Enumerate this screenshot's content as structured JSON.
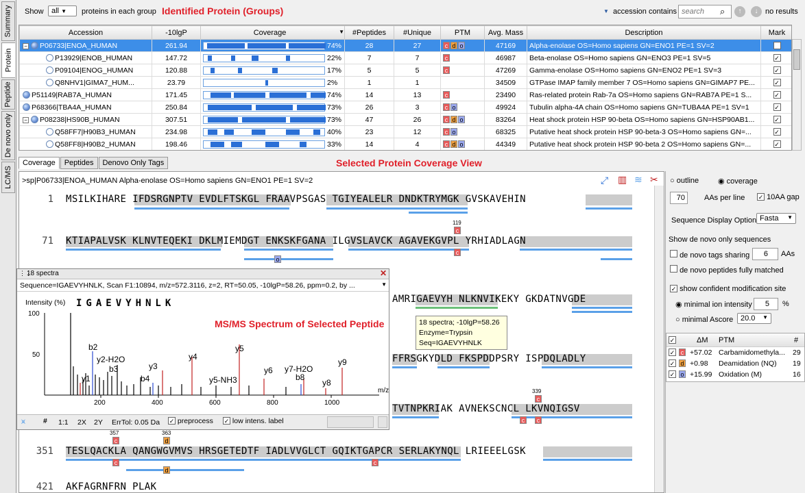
{
  "vertical_tabs": [
    "Summary",
    "Protein",
    "Peptide",
    "De novo only",
    "LC/MS"
  ],
  "topbar": {
    "show_label": "Show",
    "show_value": "all",
    "show_suffix": "proteins in each group",
    "filter_label": "accession contains",
    "search_placeholder": "search",
    "results": "no results"
  },
  "annotations": {
    "identified": "Identified Protein (Groups)",
    "coverage_view": "Selected Protein Coverage View",
    "msms": "MS/MS Spectrum of Selected Peptide"
  },
  "columns": [
    "Accession",
    "-10lgP",
    "Coverage",
    "#Peptides",
    "#Unique",
    "PTM",
    "Avg. Mass",
    "Description",
    "Mark"
  ],
  "rows": [
    {
      "acc": "P06733|ENOA_HUMAN",
      "lgp": "261.94",
      "cov": "74%",
      "pep": "28",
      "uniq": "27",
      "ptm": [
        "c",
        "d",
        "o"
      ],
      "mass": "47169",
      "desc": "Alpha-enolase OS=Homo sapiens GN=ENO1 PE=1 SV=2",
      "level": 0,
      "expand": "−",
      "selected": true
    },
    {
      "acc": "P13929|ENOB_HUMAN",
      "lgp": "147.72",
      "cov": "22%",
      "pep": "7",
      "uniq": "7",
      "ptm": [
        "c"
      ],
      "mass": "46987",
      "desc": "Beta-enolase OS=Homo sapiens GN=ENO3 PE=1 SV=5",
      "level": 1
    },
    {
      "acc": "P09104|ENOG_HUMAN",
      "lgp": "120.88",
      "cov": "17%",
      "pep": "5",
      "uniq": "5",
      "ptm": [
        "c"
      ],
      "mass": "47269",
      "desc": "Gamma-enolase OS=Homo sapiens GN=ENO2 PE=1 SV=3",
      "level": 1
    },
    {
      "acc": "Q8NHV1|GIMA7_HUM...",
      "lgp": "23.79",
      "cov": "2%",
      "pep": "1",
      "uniq": "1",
      "ptm": [],
      "mass": "34509",
      "desc": "GTPase IMAP family member 7 OS=Homo sapiens GN=GIMAP7 PE...",
      "level": 1
    },
    {
      "acc": "P51149|RAB7A_HUMAN",
      "lgp": "171.45",
      "cov": "74%",
      "pep": "14",
      "uniq": "13",
      "ptm": [
        "c"
      ],
      "mass": "23490",
      "desc": "Ras-related protein Rab-7a OS=Homo sapiens GN=RAB7A PE=1 S...",
      "level": 0
    },
    {
      "acc": "P68366|TBA4A_HUMAN",
      "lgp": "250.84",
      "cov": "73%",
      "pep": "26",
      "uniq": "3",
      "ptm": [
        "c",
        "o"
      ],
      "mass": "49924",
      "desc": "Tubulin alpha-4A chain OS=Homo sapiens GN=TUBA4A PE=1 SV=1",
      "level": 0
    },
    {
      "acc": "P08238|HS90B_HUMAN",
      "lgp": "307.51",
      "cov": "73%",
      "pep": "47",
      "uniq": "26",
      "ptm": [
        "c",
        "d",
        "o"
      ],
      "mass": "83264",
      "desc": "Heat shock protein HSP 90-beta OS=Homo sapiens GN=HSP90AB1...",
      "level": 0,
      "expand": "−"
    },
    {
      "acc": "Q58FF7|H90B3_HUMAN",
      "lgp": "234.98",
      "cov": "40%",
      "pep": "23",
      "uniq": "12",
      "ptm": [
        "c",
        "o"
      ],
      "mass": "68325",
      "desc": "Putative heat shock protein HSP 90-beta-3 OS=Homo sapiens GN=...",
      "level": 1
    },
    {
      "acc": "Q58FF8|H90B2_HUMAN",
      "lgp": "198.46",
      "cov": "33%",
      "pep": "14",
      "uniq": "4",
      "ptm": [
        "c",
        "d",
        "o"
      ],
      "mass": "44349",
      "desc": "Putative heat shock protein HSP 90-beta 2 OS=Homo sapiens GN=...",
      "level": 1
    }
  ],
  "lower_tabs": [
    "Coverage",
    "Peptides",
    "Denovo Only Tags"
  ],
  "coverage_header": ">sp|P06733|ENOA_HUMAN Alpha-enolase OS=Homo sapiens GN=ENO1 PE=1 SV=2",
  "seq_lines": [
    {
      "n": "1",
      "text": "MSILKIHARE IFDSRGNPTV EVDLFTSKGL FRAAVPSGAS TGIYEALELR DNDKTRYMGK GVSKAVEHIN"
    },
    {
      "n": "71",
      "text": "KTIAPALVSK KLNVTEQEKI DKLMIEMDGT ENKSKFGANA ILGVSLAVCK AGAVEKGVPL YRHIADLAGN"
    },
    {
      "n": "",
      "text": "AMRIGAEVYH NLKNVIKEKY GKDATNVGDE"
    },
    {
      "n": "",
      "text": "FFRSGKYDLD FKSPDDPSRY ISPDQLADLY"
    },
    {
      "n": "",
      "text": "TVTNPKRIAK AVNEKSCNCL LKVNQIGSV"
    },
    {
      "n": "351",
      "text": "TESLQACKLA QANGWGVMVS HRSGETEDTF IADLVVGLCT GQIKTGAPCR SERLAKYNQL LRIEEELGSK"
    },
    {
      "n": "421",
      "text": "AKFAGRNFRN PLAK"
    }
  ],
  "mod_positions": {
    "p119": "119",
    "p339": "339",
    "p357": "357",
    "p363": "363"
  },
  "tooltip": {
    "l1": "18 spectra; -10lgP=58.26",
    "l2": "Enzyme=Trypsin",
    "l3": "Seq=IGAEVYHNLK"
  },
  "right_panel": {
    "outline": "outline",
    "coverage": "coverage",
    "aas_value": "70",
    "aas_label": "AAs per line",
    "gap_label": "10AA gap",
    "display_label": "Sequence Display Option",
    "display_value": "Fasta",
    "denovo_title": "Show de novo only sequences",
    "tags_label": "de novo tags sharing",
    "tags_value": "6",
    "tags_suffix": "AAs",
    "fully_label": "de novo peptides fully matched",
    "conf_label": "show confident modification site",
    "ion_label": "minimal ion intensity",
    "ion_value": "5",
    "ion_suffix": "%",
    "ascore_label": "minimal Ascore",
    "ascore_value": "20.0",
    "ptm_cols": [
      "ΔM",
      "PTM",
      "#"
    ],
    "ptms": [
      {
        "code": "c",
        "dm": "+57.02",
        "name": "Carbamidomethyla...",
        "n": "29"
      },
      {
        "code": "d",
        "dm": "+0.98",
        "name": "Deamidation (NQ)",
        "n": "19"
      },
      {
        "code": "o",
        "dm": "+15.99",
        "name": "Oxidation (M)",
        "n": "16"
      }
    ]
  },
  "spectrum": {
    "title": "18 spectra",
    "info": "Sequence=IGAEVYHNLK, Scan F1:10894, m/z=572.3116, z=2, RT=50.05, -10lgP=58.26, ppm=0.2, by ...",
    "ylabel": "Intensity (%)",
    "peptide": "IGAEVYHNLK",
    "xlabel": "m/z",
    "y100": "100",
    "y50": "50",
    "xticks": [
      "200",
      "400",
      "600",
      "800",
      "1000"
    ],
    "ions": [
      "b2",
      "y2-H2O",
      "b3",
      "y1",
      "y3",
      "b4",
      "y4",
      "y5-NH3",
      "y5",
      "y6",
      "y7-H2O",
      "b8",
      "y8",
      "y9"
    ],
    "tb": {
      "ratio": "1:1",
      "x2": "2X",
      "y2": "2Y",
      "tol": "ErrTol: 0.05 Da",
      "pre": "preprocess",
      "low": "low intens. label"
    }
  }
}
